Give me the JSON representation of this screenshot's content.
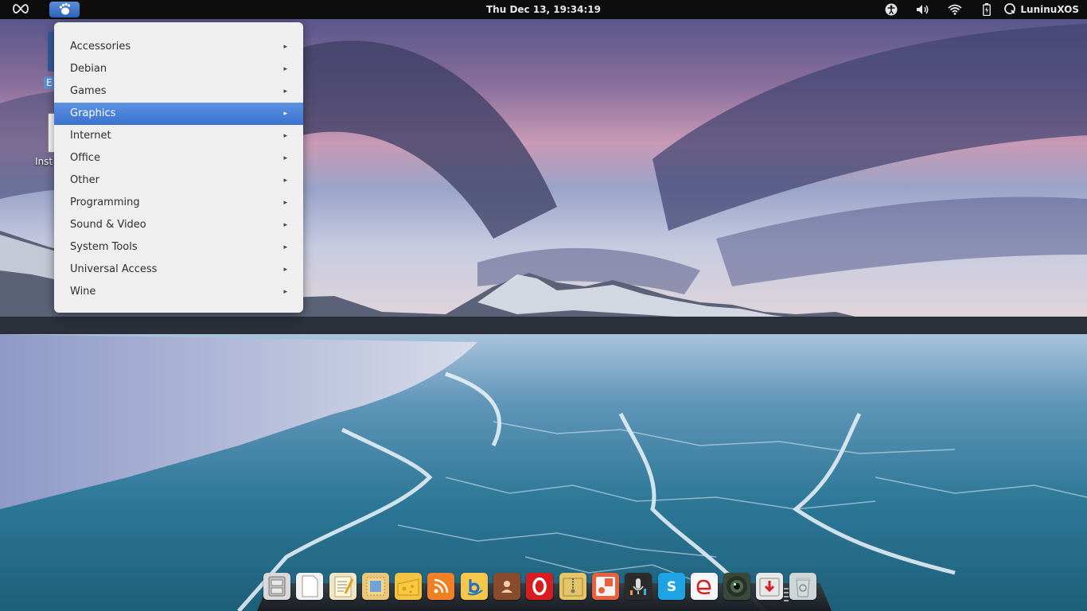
{
  "top_panel": {
    "clock": "Thu Dec 13, 19:34:19",
    "session_name": "LuninuXOS",
    "icons": [
      "infinity-icon",
      "gnome-foot-icon",
      "accessibility-icon",
      "volume-icon",
      "wifi-icon",
      "battery-icon",
      "session-icon"
    ]
  },
  "desktop": {
    "icons": [
      {
        "label": "E"
      },
      {
        "label": "Inst"
      }
    ]
  },
  "app_menu": {
    "items": [
      {
        "label": "Accessories"
      },
      {
        "label": "Debian"
      },
      {
        "label": "Games"
      },
      {
        "label": "Graphics",
        "highlighted": true
      },
      {
        "label": "Internet"
      },
      {
        "label": "Office"
      },
      {
        "label": "Other"
      },
      {
        "label": "Programming"
      },
      {
        "label": "Sound & Video"
      },
      {
        "label": "System Tools"
      },
      {
        "label": "Universal Access"
      },
      {
        "label": "Wine"
      }
    ],
    "submenu_arrow": "▸"
  },
  "dock": {
    "items": [
      {
        "name": "file-cabinet-icon",
        "color": "#d9d9d9"
      },
      {
        "name": "blank-document-icon",
        "color": "#f2f2f2"
      },
      {
        "name": "text-editor-icon",
        "color": "#efe6c8"
      },
      {
        "name": "mail-stamp-icon",
        "color": "#e9c77a"
      },
      {
        "name": "cheese-icon",
        "color": "#f5c342"
      },
      {
        "name": "rss-feed-icon",
        "color": "#f0802a"
      },
      {
        "name": "b-app-icon",
        "color": "#f5c74a"
      },
      {
        "name": "address-book-icon",
        "color": "#8a4a2c"
      },
      {
        "name": "opera-icon",
        "color": "#d81d20"
      },
      {
        "name": "archive-icon",
        "color": "#e5c56a"
      },
      {
        "name": "photo-app-icon",
        "color": "#e8603c"
      },
      {
        "name": "microphone-icon",
        "color": "#2c2c2c"
      },
      {
        "name": "skype-icon",
        "color": "#1ea4e4"
      },
      {
        "name": "e-browser-icon",
        "color": "#f4f4f4"
      },
      {
        "name": "camera-lens-icon",
        "color": "#3a4a3a"
      },
      {
        "name": "install-icon",
        "color": "#e8e8e8"
      },
      {
        "name": "trash-icon",
        "color": "#cfd6d6"
      }
    ]
  },
  "colors": {
    "panel": "#0d0d0d",
    "menu_bg": "#efefef",
    "menu_highlight": "#3a72cf"
  }
}
